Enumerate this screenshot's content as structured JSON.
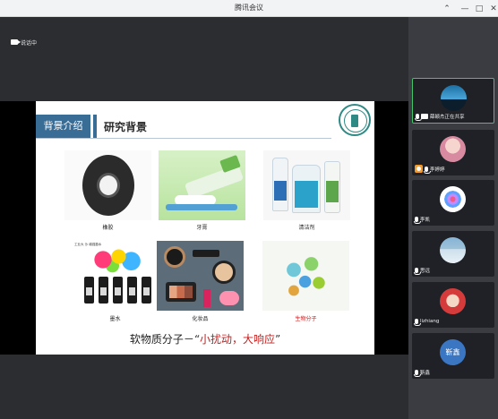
{
  "window": {
    "title": "腾讯会议",
    "controls": {
      "pin_icon": "pin-icon",
      "minimize": "—",
      "maximize": "□",
      "close": "✕"
    }
  },
  "main": {
    "speaking_label": "说话中",
    "slide": {
      "header_tag": "背景介绍",
      "header_title": "研究背景",
      "items": [
        {
          "caption": "橡胶",
          "caption_color": "#222222"
        },
        {
          "caption": "牙膏",
          "caption_color": "#222222"
        },
        {
          "caption": "清洁剂",
          "caption_color": "#222222"
        },
        {
          "caption": "墨水",
          "caption_color": "#222222"
        },
        {
          "caption": "化妆品",
          "caption_color": "#222222"
        },
        {
          "caption": "生物分子",
          "caption_color": "#c41e1e"
        }
      ],
      "ink_label": "工业大 沙 增强墨水",
      "slogan_black": "软物质分子－“",
      "slogan_red": "小扰动，大响应",
      "slogan_end": "”"
    }
  },
  "participants": [
    {
      "name": "薛颖杰正在共享",
      "active": true,
      "icons": [
        "mic-icon",
        "screen-share-icon"
      ]
    },
    {
      "name": "李婷婷",
      "active": false,
      "icons": [
        "host-icon",
        "mic-icon"
      ]
    },
    {
      "name": "李凯",
      "active": false,
      "icons": [
        "mic-icon"
      ]
    },
    {
      "name": "思远",
      "active": false,
      "icons": [
        "mic-icon"
      ]
    },
    {
      "name": "lizhiang",
      "active": false,
      "icons": [
        "mic-icon"
      ]
    },
    {
      "name": "靳鑫",
      "active": false,
      "avatar_text": "靳鑫",
      "icons": [
        "mic-icon"
      ]
    }
  ],
  "colors": {
    "titlebar": "#f2f3f5",
    "background": "#2b2d31",
    "sidebar": "#3a3c41",
    "active_border": "#41c46b",
    "slide_accent": "#3a6d96",
    "slogan_red": "#c41e1e"
  }
}
